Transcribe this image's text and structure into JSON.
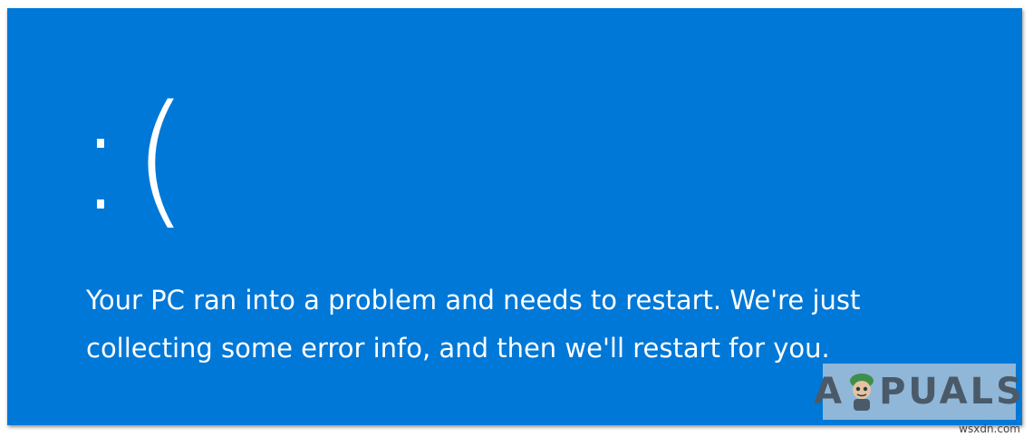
{
  "screen": {
    "background_color": "#0078d7",
    "text_color": "#ffffff",
    "emoticon": ":(",
    "message": "Your PC ran into a problem and needs to restart. We're just collecting some error info, and then we'll restart for you."
  },
  "watermark": {
    "brand_left": "A",
    "brand_right": "PUALS",
    "mascot_icon": "appuals-mascot-icon"
  },
  "site_label": "wsxdn.com"
}
